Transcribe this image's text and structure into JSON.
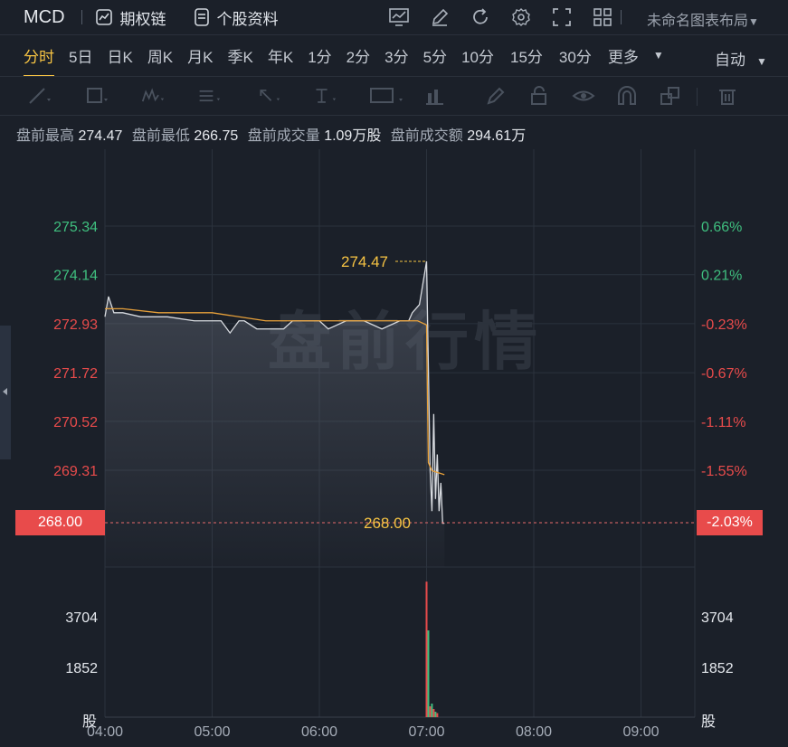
{
  "topbar": {
    "ticker": "MCD",
    "options_chain": "期权链",
    "stock_profile": "个股资料",
    "layout_select": "未命名图表布局"
  },
  "periods": [
    "分时",
    "5日",
    "日K",
    "周K",
    "月K",
    "季K",
    "年K",
    "1分",
    "2分",
    "3分",
    "5分",
    "10分",
    "15分",
    "30分",
    "更多"
  ],
  "active_period": "分时",
  "auto_label": "自动",
  "info": {
    "high_label": "盘前最高",
    "high_value": "274.47",
    "low_label": "盘前最低",
    "low_value": "266.75",
    "vol_label": "盘前成交量",
    "vol_value": "1.09万股",
    "amt_label": "盘前成交额",
    "amt_value": "294.61万"
  },
  "watermark": "盘前行情",
  "price_axis_left": [
    "275.34",
    "274.14",
    "272.93",
    "271.72",
    "270.52",
    "269.31"
  ],
  "price_axis_right": [
    "0.66%",
    "0.21%",
    "-0.23%",
    "-0.67%",
    "-1.11%",
    "-1.55%"
  ],
  "current_price_tag": "268.00",
  "current_pct_tag": "-2.03%",
  "high_marker": "274.47",
  "last_marker": "268.00",
  "volume_axis": [
    "3704",
    "1852"
  ],
  "volume_unit": "股",
  "time_axis": [
    "04:00",
    "05:00",
    "06:00",
    "07:00",
    "08:00",
    "09:00"
  ],
  "colors": {
    "up": "#3fbf7f",
    "down": "#e84b4b",
    "accent": "#f6c343",
    "avg_line": "#e8a13a"
  },
  "chart_data": {
    "type": "line",
    "price_line": {
      "x": [
        "04:00",
        "04:02",
        "04:05",
        "04:10",
        "04:20",
        "04:35",
        "04:50",
        "05:05",
        "05:10",
        "05:15",
        "05:18",
        "05:25",
        "05:40",
        "05:45",
        "05:55",
        "06:00",
        "06:05",
        "06:15",
        "06:25",
        "06:35",
        "06:45",
        "06:50",
        "06:52",
        "06:56",
        "07:00",
        "07:02",
        "07:03",
        "07:04",
        "07:05",
        "07:06",
        "07:07",
        "07:08",
        "07:09",
        "07:10"
      ],
      "y": [
        273.1,
        273.6,
        273.2,
        273.2,
        273.1,
        273.1,
        273.0,
        273.0,
        272.7,
        273.0,
        273.0,
        272.8,
        272.8,
        273.0,
        273.0,
        273.0,
        272.8,
        273.0,
        273.0,
        272.8,
        273.0,
        273.0,
        273.2,
        273.4,
        274.47,
        269.3,
        268.3,
        270.7,
        268.6,
        269.7,
        268.3,
        269.0,
        268.0,
        268.0
      ]
    },
    "avg_line": {
      "x": [
        "04:00",
        "04:10",
        "04:30",
        "05:00",
        "05:30",
        "06:00",
        "06:30",
        "06:55",
        "07:00",
        "07:01",
        "07:03",
        "07:10"
      ],
      "y": [
        273.3,
        273.3,
        273.2,
        273.2,
        273.0,
        273.0,
        273.0,
        273.0,
        272.9,
        269.5,
        269.3,
        269.2
      ]
    },
    "volume": {
      "x": [
        "07:00",
        "07:01",
        "07:02",
        "07:03",
        "07:04",
        "07:05",
        "07:06"
      ],
      "values": [
        5000,
        3200,
        400,
        500,
        300,
        200,
        150
      ]
    }
  }
}
